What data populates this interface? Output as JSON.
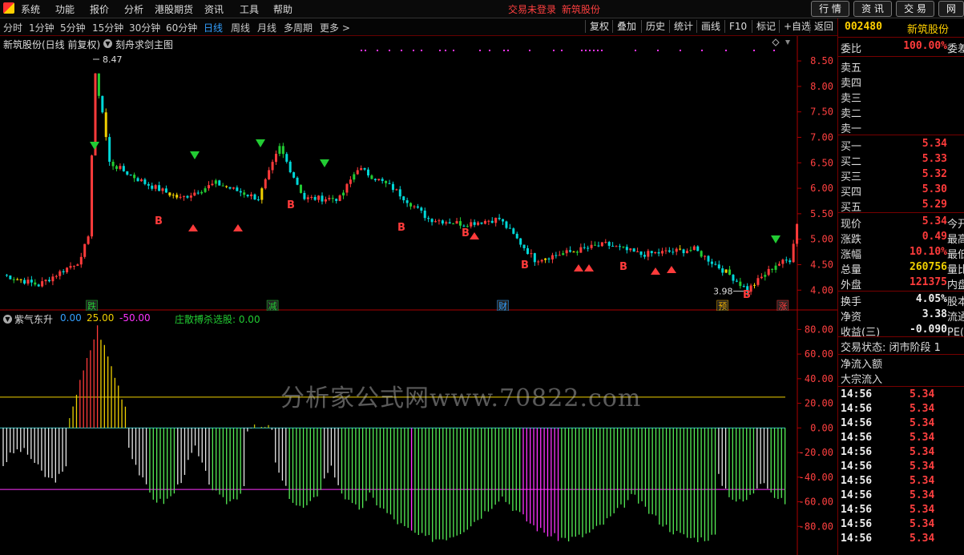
{
  "menu": [
    "系统",
    "功能",
    "报价",
    "分析",
    "港股期货",
    "资讯",
    "工具",
    "帮助"
  ],
  "status_text": [
    "交易未登录",
    "新筑股份"
  ],
  "top_buttons": [
    "行 情",
    "资 讯",
    "交 易",
    "网"
  ],
  "timeframes": [
    "分时",
    "1分钟",
    "5分钟",
    "15分钟",
    "30分钟",
    "60分钟",
    "日线",
    "周线",
    "月线",
    "多周期",
    "更多 >"
  ],
  "active_timeframe": "日线",
  "tools": [
    "复权",
    "叠加",
    "历史",
    "统计",
    "画线",
    "F10",
    "标记",
    "+自选",
    "返回"
  ],
  "chart_title": "新筑股份(日线 前复权)",
  "chart_subtitle": "刻舟求剑主图",
  "colors": {
    "up": "#ff3b3b",
    "down": "#00d8d8",
    "accent": "#33a0ff",
    "green": "#22cc33",
    "yellow": "#f0d000",
    "magenta": "#ff33ff"
  },
  "chart_data": [
    {
      "type": "candlestick",
      "title": "新筑股份(日线 前复权)",
      "ylim": [
        3.8,
        8.8
      ],
      "yticks": [
        "8.50",
        "8.00",
        "7.50",
        "7.00",
        "6.50",
        "6.00",
        "5.50",
        "5.00",
        "4.50",
        "4.00"
      ],
      "annotations": {
        "high": "8.47",
        "low": "3.98"
      },
      "marker_labels": [
        {
          "text": "跌",
          "color": "#22cc33",
          "index": 25
        },
        {
          "text": "减",
          "color": "#22cc33",
          "index": 76
        },
        {
          "text": "财",
          "color": "#33a0ff",
          "index": 141
        },
        {
          "text": "预",
          "color": "#f0b000",
          "index": 203
        },
        {
          "text": "涨",
          "color": "#ff3b3b",
          "index": 220
        }
      ]
    },
    {
      "type": "bar",
      "title": "紫气东升",
      "legend": [
        {
          "text": "0.00",
          "color": "#33a0ff"
        },
        {
          "text": "25.00",
          "color": "#f0d000"
        },
        {
          "text": "-50.00",
          "color": "#ff33ff"
        }
      ],
      "secondary_title": "庄散搏杀选股: 0.00",
      "ylim": [
        -100,
        90
      ],
      "yticks": [
        "80.00",
        "60.00",
        "40.00",
        "20.00",
        "0.00",
        "-20.00",
        "-40.00",
        "-60.00",
        "-80.00"
      ],
      "hlines": [
        25,
        0,
        -50
      ]
    }
  ],
  "panel": {
    "code": "002480",
    "name": "新筑股份",
    "weibi": {
      "label": "委比",
      "value": "100.00%",
      "extra": "委差"
    },
    "asks": [
      {
        "label": "卖五"
      },
      {
        "label": "卖四"
      },
      {
        "label": "卖三"
      },
      {
        "label": "卖二"
      },
      {
        "label": "卖一"
      }
    ],
    "bids": [
      {
        "label": "买一",
        "price": "5.34"
      },
      {
        "label": "买二",
        "price": "5.33"
      },
      {
        "label": "买三",
        "price": "5.32"
      },
      {
        "label": "买四",
        "price": "5.30"
      },
      {
        "label": "买五",
        "price": "5.29"
      }
    ],
    "quote": [
      {
        "label": "现价",
        "value": "5.34",
        "extra": "今开",
        "color": "#ff3b3b"
      },
      {
        "label": "涨跌",
        "value": "0.49",
        "extra": "最高",
        "color": "#ff3b3b"
      },
      {
        "label": "涨幅",
        "value": "10.10%",
        "extra": "最低",
        "color": "#ff3b3b"
      },
      {
        "label": "总量",
        "value": "260756",
        "extra": "量比",
        "color": "#f0d000"
      },
      {
        "label": "外盘",
        "value": "121375",
        "extra": "内盘",
        "color": "#ff3b3b"
      }
    ],
    "stats": [
      {
        "label": "换手",
        "value": "4.05%",
        "extra": "股本",
        "color": "#eeeeee"
      },
      {
        "label": "净资",
        "value": "3.38",
        "extra": "流通",
        "color": "#eeeeee"
      },
      {
        "label": "收益(三)",
        "value": "-0.090",
        "extra": "PE(动",
        "color": "#eeeeee"
      }
    ],
    "trade_status": "交易状态: 闭市阶段 1",
    "net_inflow": "净流入额",
    "block_inflow": "大宗流入",
    "trades": [
      {
        "time": "14:56",
        "price": "5.34"
      },
      {
        "time": "14:56",
        "price": "5.34"
      },
      {
        "time": "14:56",
        "price": "5.34"
      },
      {
        "time": "14:56",
        "price": "5.34"
      },
      {
        "time": "14:56",
        "price": "5.34"
      },
      {
        "time": "14:56",
        "price": "5.34"
      },
      {
        "time": "14:56",
        "price": "5.34"
      },
      {
        "time": "14:56",
        "price": "5.34"
      },
      {
        "time": "14:56",
        "price": "5.34"
      },
      {
        "time": "14:56",
        "price": "5.34"
      },
      {
        "time": "14:56",
        "price": "5.34"
      }
    ]
  },
  "watermark": "分析家公式网www.70822.com"
}
